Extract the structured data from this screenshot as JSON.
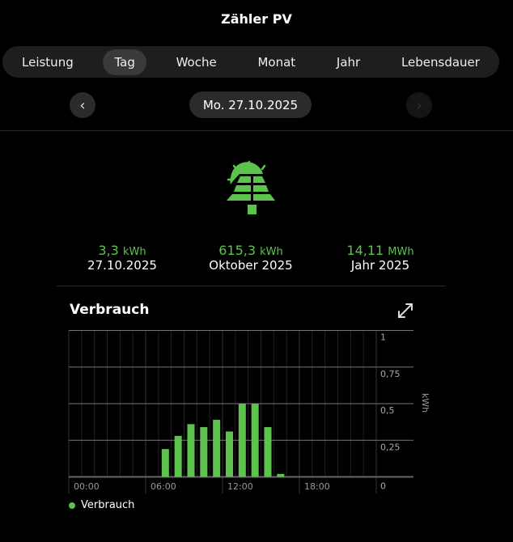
{
  "header": {
    "title": "Zähler PV"
  },
  "tabs": [
    {
      "label": "Leistung"
    },
    {
      "label": "Tag",
      "active": true
    },
    {
      "label": "Woche"
    },
    {
      "label": "Monat"
    },
    {
      "label": "Jahr"
    },
    {
      "label": "Lebensdauer"
    }
  ],
  "date_nav": {
    "date": "Mo. 27.10.2025",
    "prev_icon": "chevron-left",
    "next_icon": "chevron-right"
  },
  "icon": "solar-panel-icon",
  "stats": [
    {
      "value": "3,3",
      "unit": "kWh",
      "label": "27.10.2025"
    },
    {
      "value": "615,3",
      "unit": "kWh",
      "label": "Oktober 2025"
    },
    {
      "value": "14,11",
      "unit": "MWh",
      "label": "Jahr 2025"
    }
  ],
  "section": {
    "title": "Verbrauch"
  },
  "colors": {
    "accent": "#5ec24f"
  },
  "chart_data": {
    "type": "bar",
    "title": "Verbrauch",
    "ylabel": "kWh",
    "ylim": [
      0,
      1
    ],
    "yticks": [
      "0",
      "0,25",
      "0,5",
      "0,75",
      "1"
    ],
    "xticks": [
      "00:00",
      "06:00",
      "12:00",
      "18:00"
    ],
    "hours": [
      0,
      1,
      2,
      3,
      4,
      5,
      6,
      7,
      8,
      9,
      10,
      11,
      12,
      13,
      14,
      15,
      16,
      17,
      18,
      19,
      20,
      21,
      22,
      23
    ],
    "values": [
      0,
      0,
      0,
      0,
      0,
      0,
      0,
      0.19,
      0.28,
      0.36,
      0.34,
      0.39,
      0.31,
      0.5,
      0.5,
      0.34,
      0.02,
      0,
      0,
      0,
      0,
      0,
      0,
      0
    ],
    "legend": [
      "Verbrauch"
    ]
  }
}
